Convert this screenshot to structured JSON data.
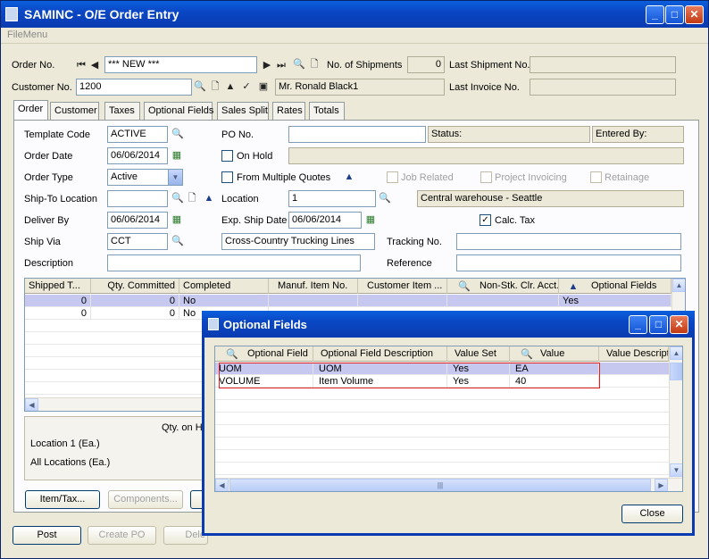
{
  "window": {
    "title": "SAMINC - O/E Order Entry",
    "menu": "FileMenu"
  },
  "header": {
    "order_no_label": "Order No.",
    "order_no_value": "*** NEW ***",
    "shipments_label": "No. of Shipments",
    "shipments_value": "0",
    "last_shipment_label": "Last Shipment No.",
    "customer_no_label": "Customer No.",
    "customer_no_value": "1200",
    "customer_name": "Mr. Ronald Black1",
    "last_invoice_label": "Last Invoice No."
  },
  "tabs": [
    "Order",
    "Customer",
    "Taxes",
    "Optional Fields",
    "Sales Split",
    "Rates",
    "Totals"
  ],
  "form": {
    "template_code_label": "Template Code",
    "template_code": "ACTIVE",
    "po_no_label": "PO No.",
    "status_label": "Status:",
    "entered_by_label": "Entered By:",
    "order_date_label": "Order Date",
    "order_date": "06/06/2014",
    "on_hold_label": "On Hold",
    "order_type_label": "Order Type",
    "order_type": "Active",
    "from_multiple_quotes_label": "From Multiple Quotes",
    "job_related_label": "Job Related",
    "project_invoicing_label": "Project Invoicing",
    "retainage_label": "Retainage",
    "ship_to_label": "Ship-To Location",
    "location_label": "Location",
    "location_value": "1",
    "location_desc": "Central warehouse - Seattle",
    "deliver_by_label": "Deliver By",
    "deliver_by": "06/06/2014",
    "exp_ship_date_label": "Exp. Ship Date",
    "exp_ship_date": "06/06/2014",
    "calc_tax_label": "Calc. Tax",
    "ship_via_label": "Ship Via",
    "ship_via": "CCT",
    "ship_via_desc": "Cross-Country Trucking Lines",
    "tracking_no_label": "Tracking No.",
    "description_label": "Description",
    "reference_label": "Reference"
  },
  "detail_grid": {
    "columns": [
      "Shipped T...",
      "Qty. Committed",
      "Completed",
      "Manuf. Item No.",
      "Customer Item ...",
      "Non-Stk. Clr. Acct.",
      "Optional Fields"
    ],
    "rows": [
      [
        "0",
        "0",
        "No",
        "",
        "",
        "",
        "Yes"
      ],
      [
        "0",
        "0",
        "No",
        "",
        "",
        "",
        ""
      ]
    ]
  },
  "lower": {
    "qty_on_hand_label": "Qty. on H",
    "location_line": "Location  1 (Ea.)",
    "all_locations": "All Locations (Ea.)"
  },
  "buttons": {
    "item_tax": "Item/Tax...",
    "components": "Components...",
    "post": "Post",
    "create_po": "Create PO",
    "delete": "Dele"
  },
  "dialog": {
    "title": "Optional Fields",
    "columns": [
      "Optional Field",
      "Optional Field Description",
      "Value Set",
      "Value",
      "Value Descripti"
    ],
    "rows": [
      [
        "UOM",
        "UOM",
        "Yes",
        "EA",
        ""
      ],
      [
        "VOLUME",
        "Item Volume",
        "Yes",
        "40",
        ""
      ]
    ],
    "close": "Close"
  }
}
